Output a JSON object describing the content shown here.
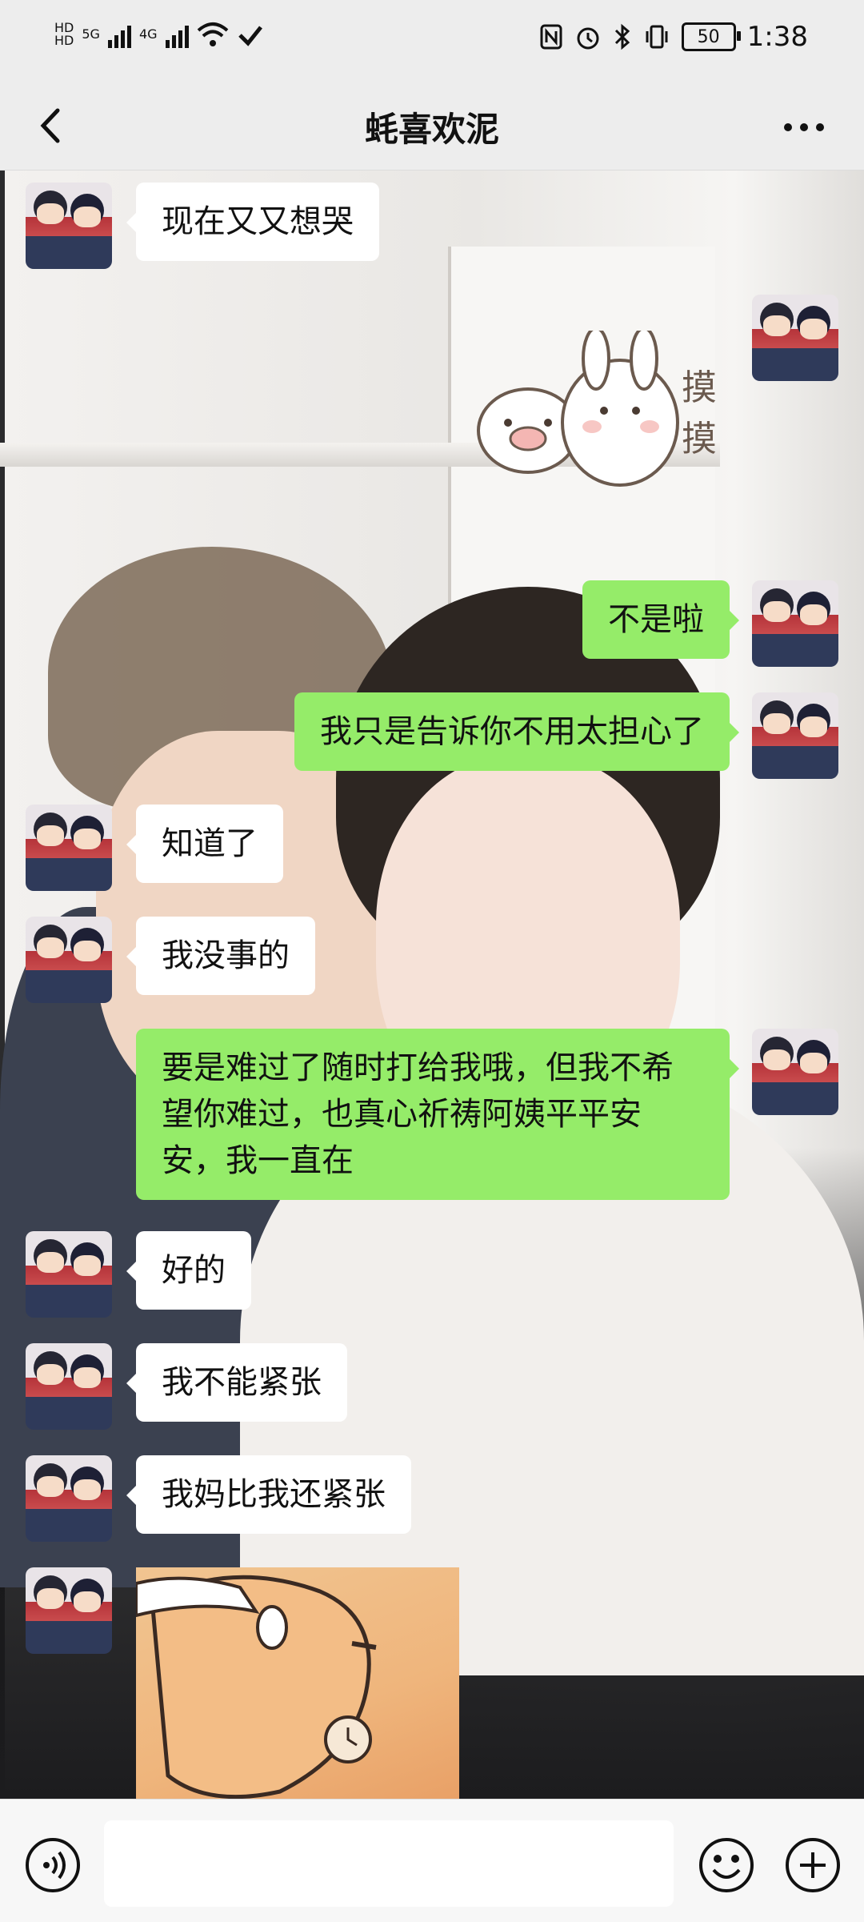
{
  "status_bar": {
    "net_left": "5G",
    "net_right": "4G",
    "battery": "50",
    "time": "1:38",
    "icons": [
      "hd-icon",
      "signal-icon",
      "wifi-icon",
      "nfc-icon",
      "alarm-icon",
      "bluetooth-icon",
      "vibrate-icon",
      "battery-icon"
    ]
  },
  "header": {
    "title": "蚝喜欢泥",
    "back_icon": "chevron-left-icon",
    "more_icon": "more-dots-icon"
  },
  "messages": [
    {
      "side": "in",
      "type": "text",
      "text": "现在又又想哭"
    },
    {
      "side": "out",
      "type": "sticker",
      "text": "摸摸"
    },
    {
      "side": "out",
      "type": "text",
      "text": "不是啦"
    },
    {
      "side": "out",
      "type": "text",
      "text": "我只是告诉你不用太担心了"
    },
    {
      "side": "in",
      "type": "text",
      "text": "知道了"
    },
    {
      "side": "in",
      "type": "text",
      "text": "我没事的"
    },
    {
      "side": "out",
      "type": "text",
      "text": "要是难过了随时打给我哦，但我不希望你难过，也真心祈祷阿姨平平安安，我一直在"
    },
    {
      "side": "in",
      "type": "text",
      "text": "好的"
    },
    {
      "side": "in",
      "type": "text",
      "text": "我不能紧张"
    },
    {
      "side": "in",
      "type": "text",
      "text": "我妈比我还紧张"
    },
    {
      "side": "in",
      "type": "image",
      "text": ""
    }
  ],
  "input_bar": {
    "placeholder": "",
    "icons": [
      "voice-icon",
      "emoji-icon",
      "plus-icon"
    ]
  },
  "colors": {
    "out_bubble": "#95ec69",
    "in_bubble": "#ffffff",
    "bar_bg": "#ededed"
  }
}
